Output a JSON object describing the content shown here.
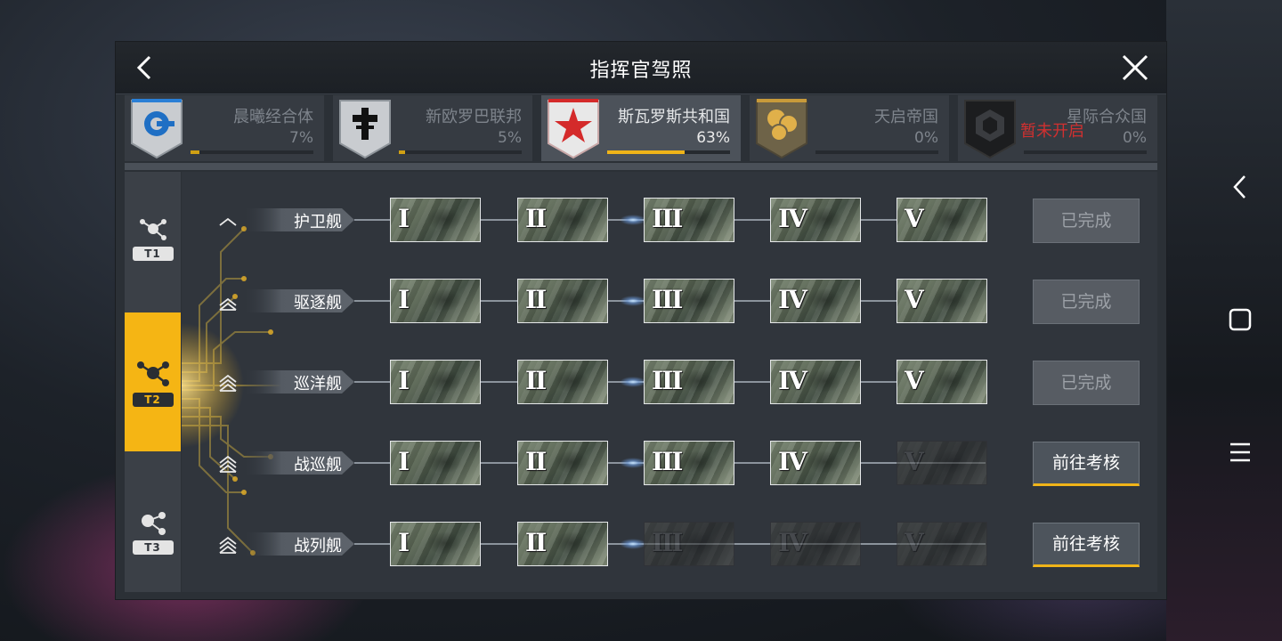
{
  "title": "指挥官驾照",
  "factions": [
    {
      "name": "晨曦经合体",
      "percent": "7%",
      "progress": 0.07,
      "active": false,
      "locked": false,
      "emblem": "crescent-ring-icon",
      "color": "#1f6fc4"
    },
    {
      "name": "新欧罗巴联邦",
      "percent": "5%",
      "progress": 0.05,
      "active": false,
      "locked": false,
      "emblem": "cross-icon",
      "color": "#111111"
    },
    {
      "name": "斯瓦罗斯共和国",
      "percent": "63%",
      "progress": 0.63,
      "active": true,
      "locked": false,
      "emblem": "red-star-icon",
      "color": "#d42a2a"
    },
    {
      "name": "天启帝国",
      "percent": "0%",
      "progress": 0.0,
      "active": false,
      "locked": false,
      "emblem": "orb-cluster-icon",
      "color": "#c89a3a"
    },
    {
      "name": "星际合众国",
      "percent": "0%",
      "progress": 0.0,
      "active": false,
      "locked": true,
      "locked_text": "暂未开启",
      "emblem": "hex-cube-icon",
      "color": "#222222"
    }
  ],
  "tiers": [
    {
      "label": "T1",
      "active": false
    },
    {
      "label": "T2",
      "active": true
    },
    {
      "label": "T3",
      "active": false
    }
  ],
  "classes": [
    {
      "name": "护卫舰",
      "rank": 1,
      "unlocked": 5,
      "status": "已完成",
      "completed": true
    },
    {
      "name": "驱逐舰",
      "rank": 2,
      "unlocked": 5,
      "status": "已完成",
      "completed": true
    },
    {
      "name": "巡洋舰",
      "rank": 3,
      "unlocked": 5,
      "status": "已完成",
      "completed": true
    },
    {
      "name": "战巡舰",
      "rank": 4,
      "unlocked": 4,
      "status": "前往考核",
      "completed": false
    },
    {
      "name": "战列舰",
      "rank": 5,
      "unlocked": 2,
      "status": "前往考核",
      "completed": false
    }
  ],
  "levels": [
    "I",
    "II",
    "III",
    "IV",
    "V"
  ],
  "accent": "#f5b514"
}
